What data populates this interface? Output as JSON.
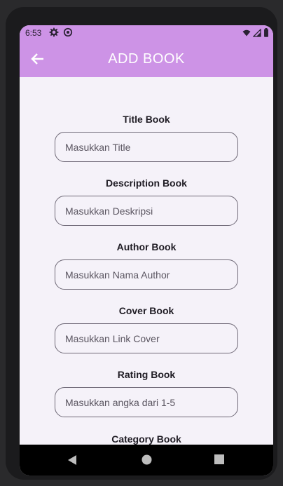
{
  "status_bar": {
    "time": "6:53"
  },
  "app_bar": {
    "title": "ADD BOOK"
  },
  "form": {
    "fields": [
      {
        "label": "Title Book",
        "placeholder": "Masukkan Title"
      },
      {
        "label": "Description Book",
        "placeholder": "Masukkan Deskripsi"
      },
      {
        "label": "Author Book",
        "placeholder": "Masukkan Nama Author"
      },
      {
        "label": "Cover Book",
        "placeholder": "Masukkan Link Cover"
      },
      {
        "label": "Rating Book",
        "placeholder": "Masukkan angka dari 1-5"
      },
      {
        "label": "Category Book"
      }
    ]
  },
  "colors": {
    "app_bar": "#cd93e6",
    "background": "#f5f2f9"
  },
  "icons": [
    "settings-icon",
    "sync-icon",
    "wifi-icon",
    "signal-icon",
    "battery-icon",
    "back-arrow-icon",
    "nav-back-icon",
    "nav-home-icon",
    "nav-recents-icon"
  ]
}
